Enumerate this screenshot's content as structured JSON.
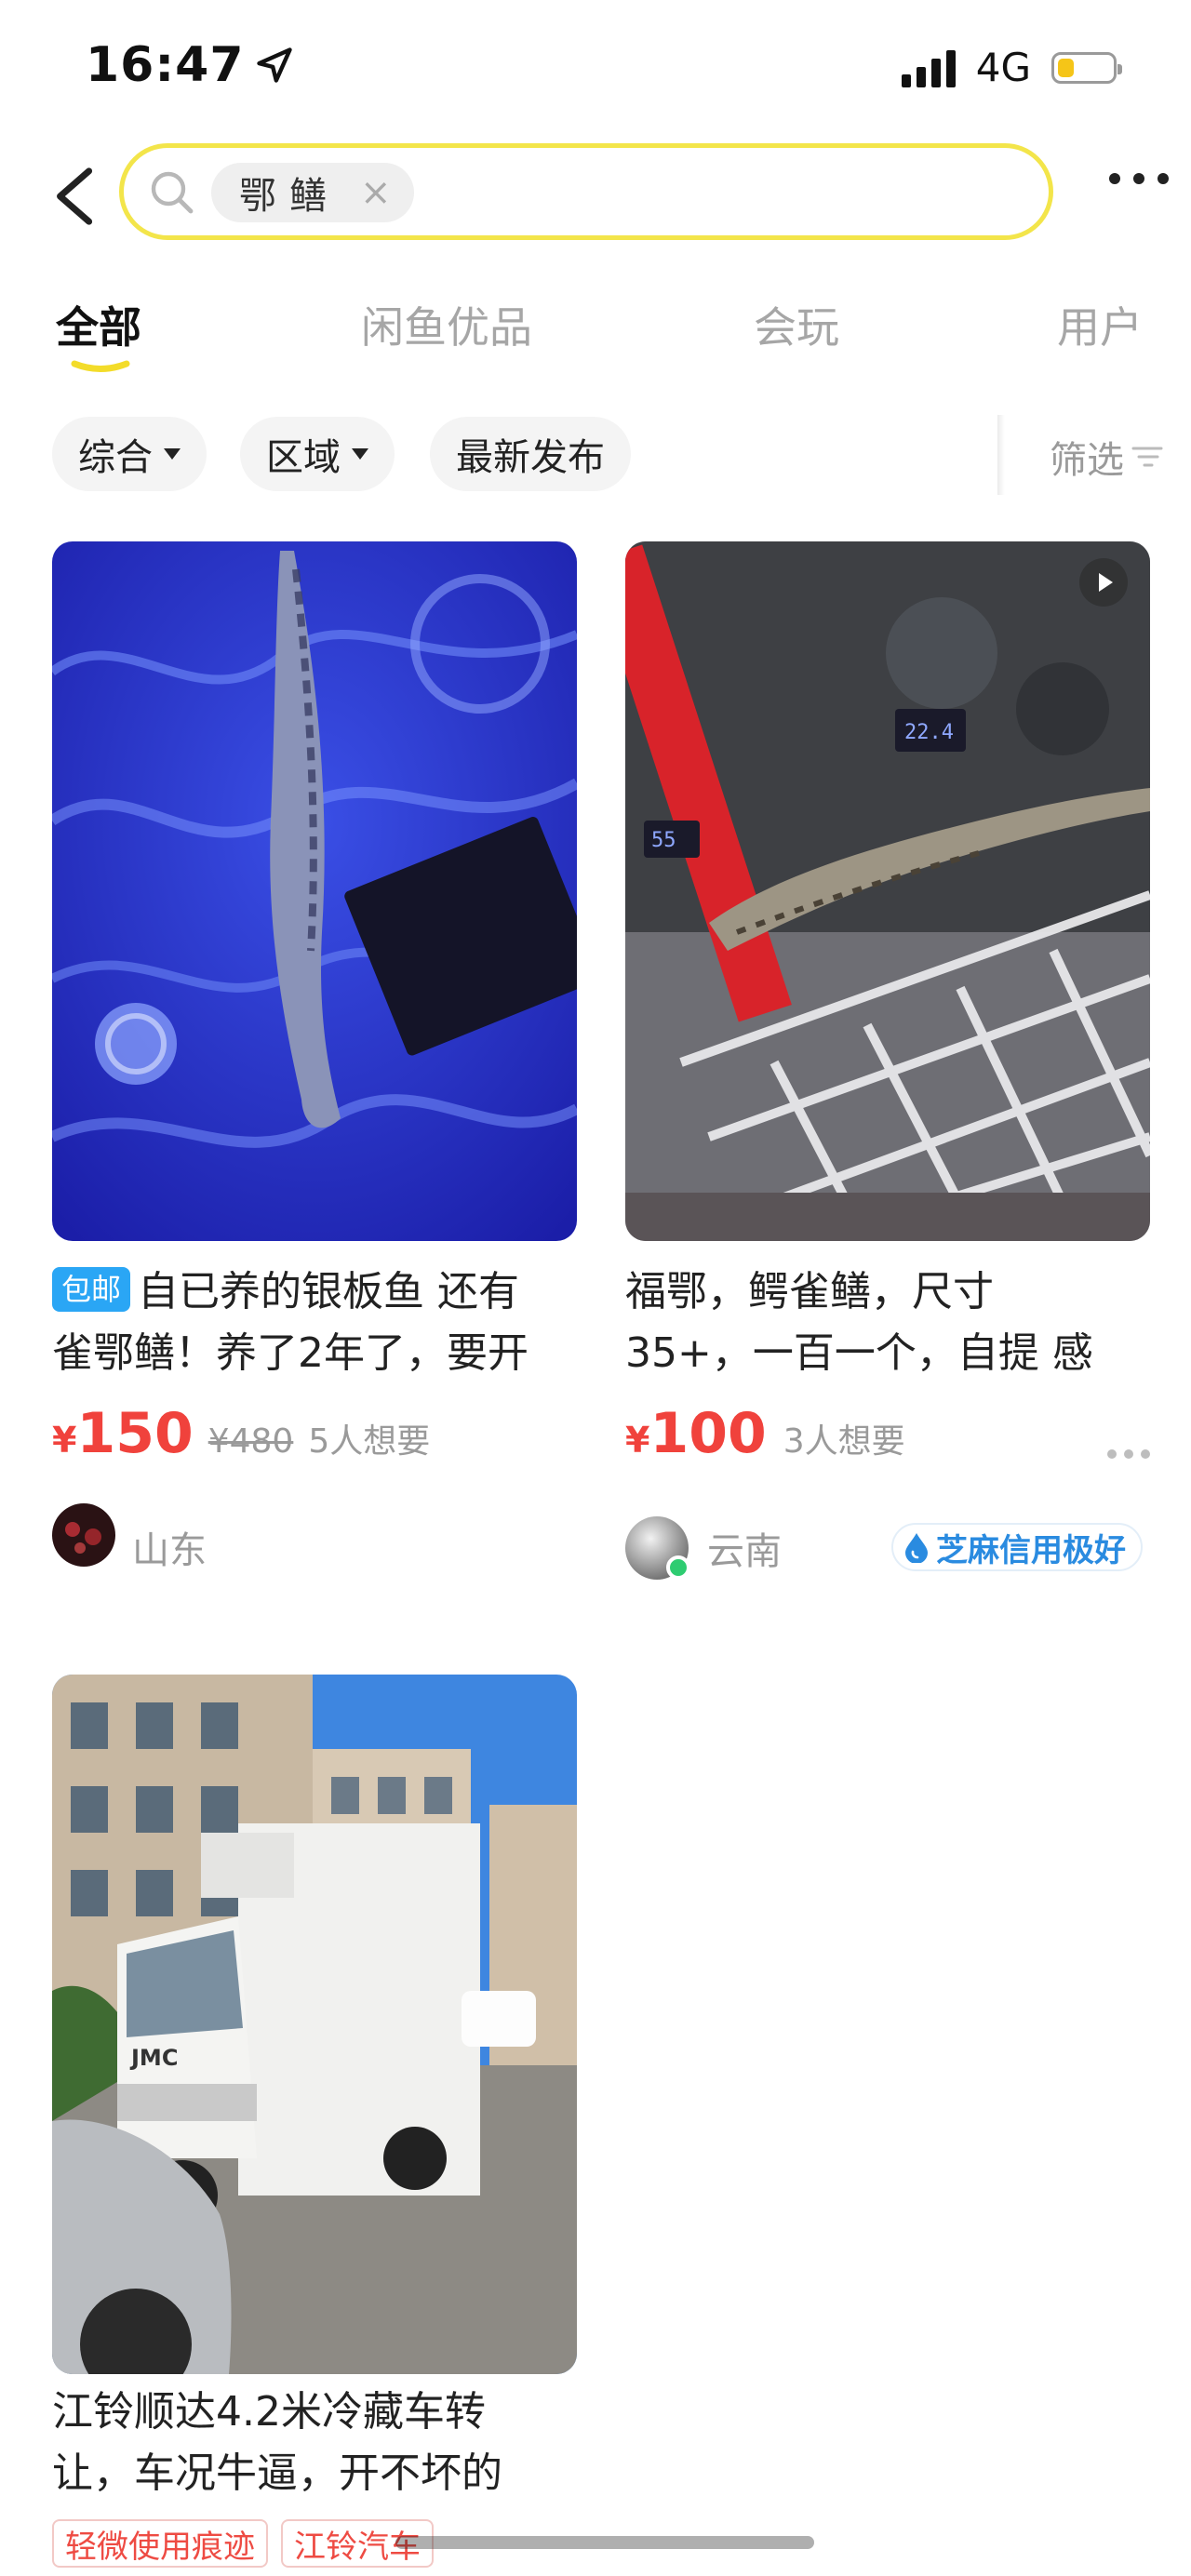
{
  "status_bar": {
    "time": "16:47",
    "network": "4G",
    "battery_level": 0.3
  },
  "search": {
    "query": "鄂鳝"
  },
  "tabs": [
    {
      "label": "全部",
      "active": true
    },
    {
      "label": "闲鱼优品",
      "active": false
    },
    {
      "label": "会玩",
      "active": false
    },
    {
      "label": "用户",
      "active": false
    }
  ],
  "filters": {
    "sort": "综合",
    "region": "区域",
    "latest": "最新发布",
    "filter": "筛选"
  },
  "listings": [
    {
      "badge": "包邮",
      "title_line1": "自已养的银板鱼 还有",
      "title_line2": "雀鄂鳝！养了2年了，要开",
      "currency": "¥",
      "price": "150",
      "original_price": "¥480",
      "wants": "5人想要",
      "location": "山东"
    },
    {
      "title_line1": "福鄂，鳄雀鳝，尺寸",
      "title_line2": "35+，一百一个，自提 感",
      "currency": "¥",
      "price": "100",
      "wants": "3人想要",
      "location": "云南",
      "credit": "芝麻信用极好",
      "tank_display_left": "55",
      "tank_display_right": "22.4"
    },
    {
      "title_line1": "江铃顺达4.2米冷藏车转",
      "title_line2": "让，车况牛逼，开不坏的",
      "tags": [
        "轻微使用痕迹",
        "江铃汽车"
      ],
      "truck_brand": "JMC"
    }
  ],
  "colors": {
    "accent_yellow": "#f3e54a",
    "price_red": "#f0423c",
    "badge_blue": "#2aa6f5",
    "credit_blue": "#2a8be0"
  },
  "icons": [
    "location-arrow-icon",
    "back-icon",
    "search-icon",
    "clear-icon",
    "more-icon",
    "caret-down-icon",
    "filter-icon",
    "video-play-icon",
    "credit-drop-icon",
    "more-dots-icon"
  ]
}
